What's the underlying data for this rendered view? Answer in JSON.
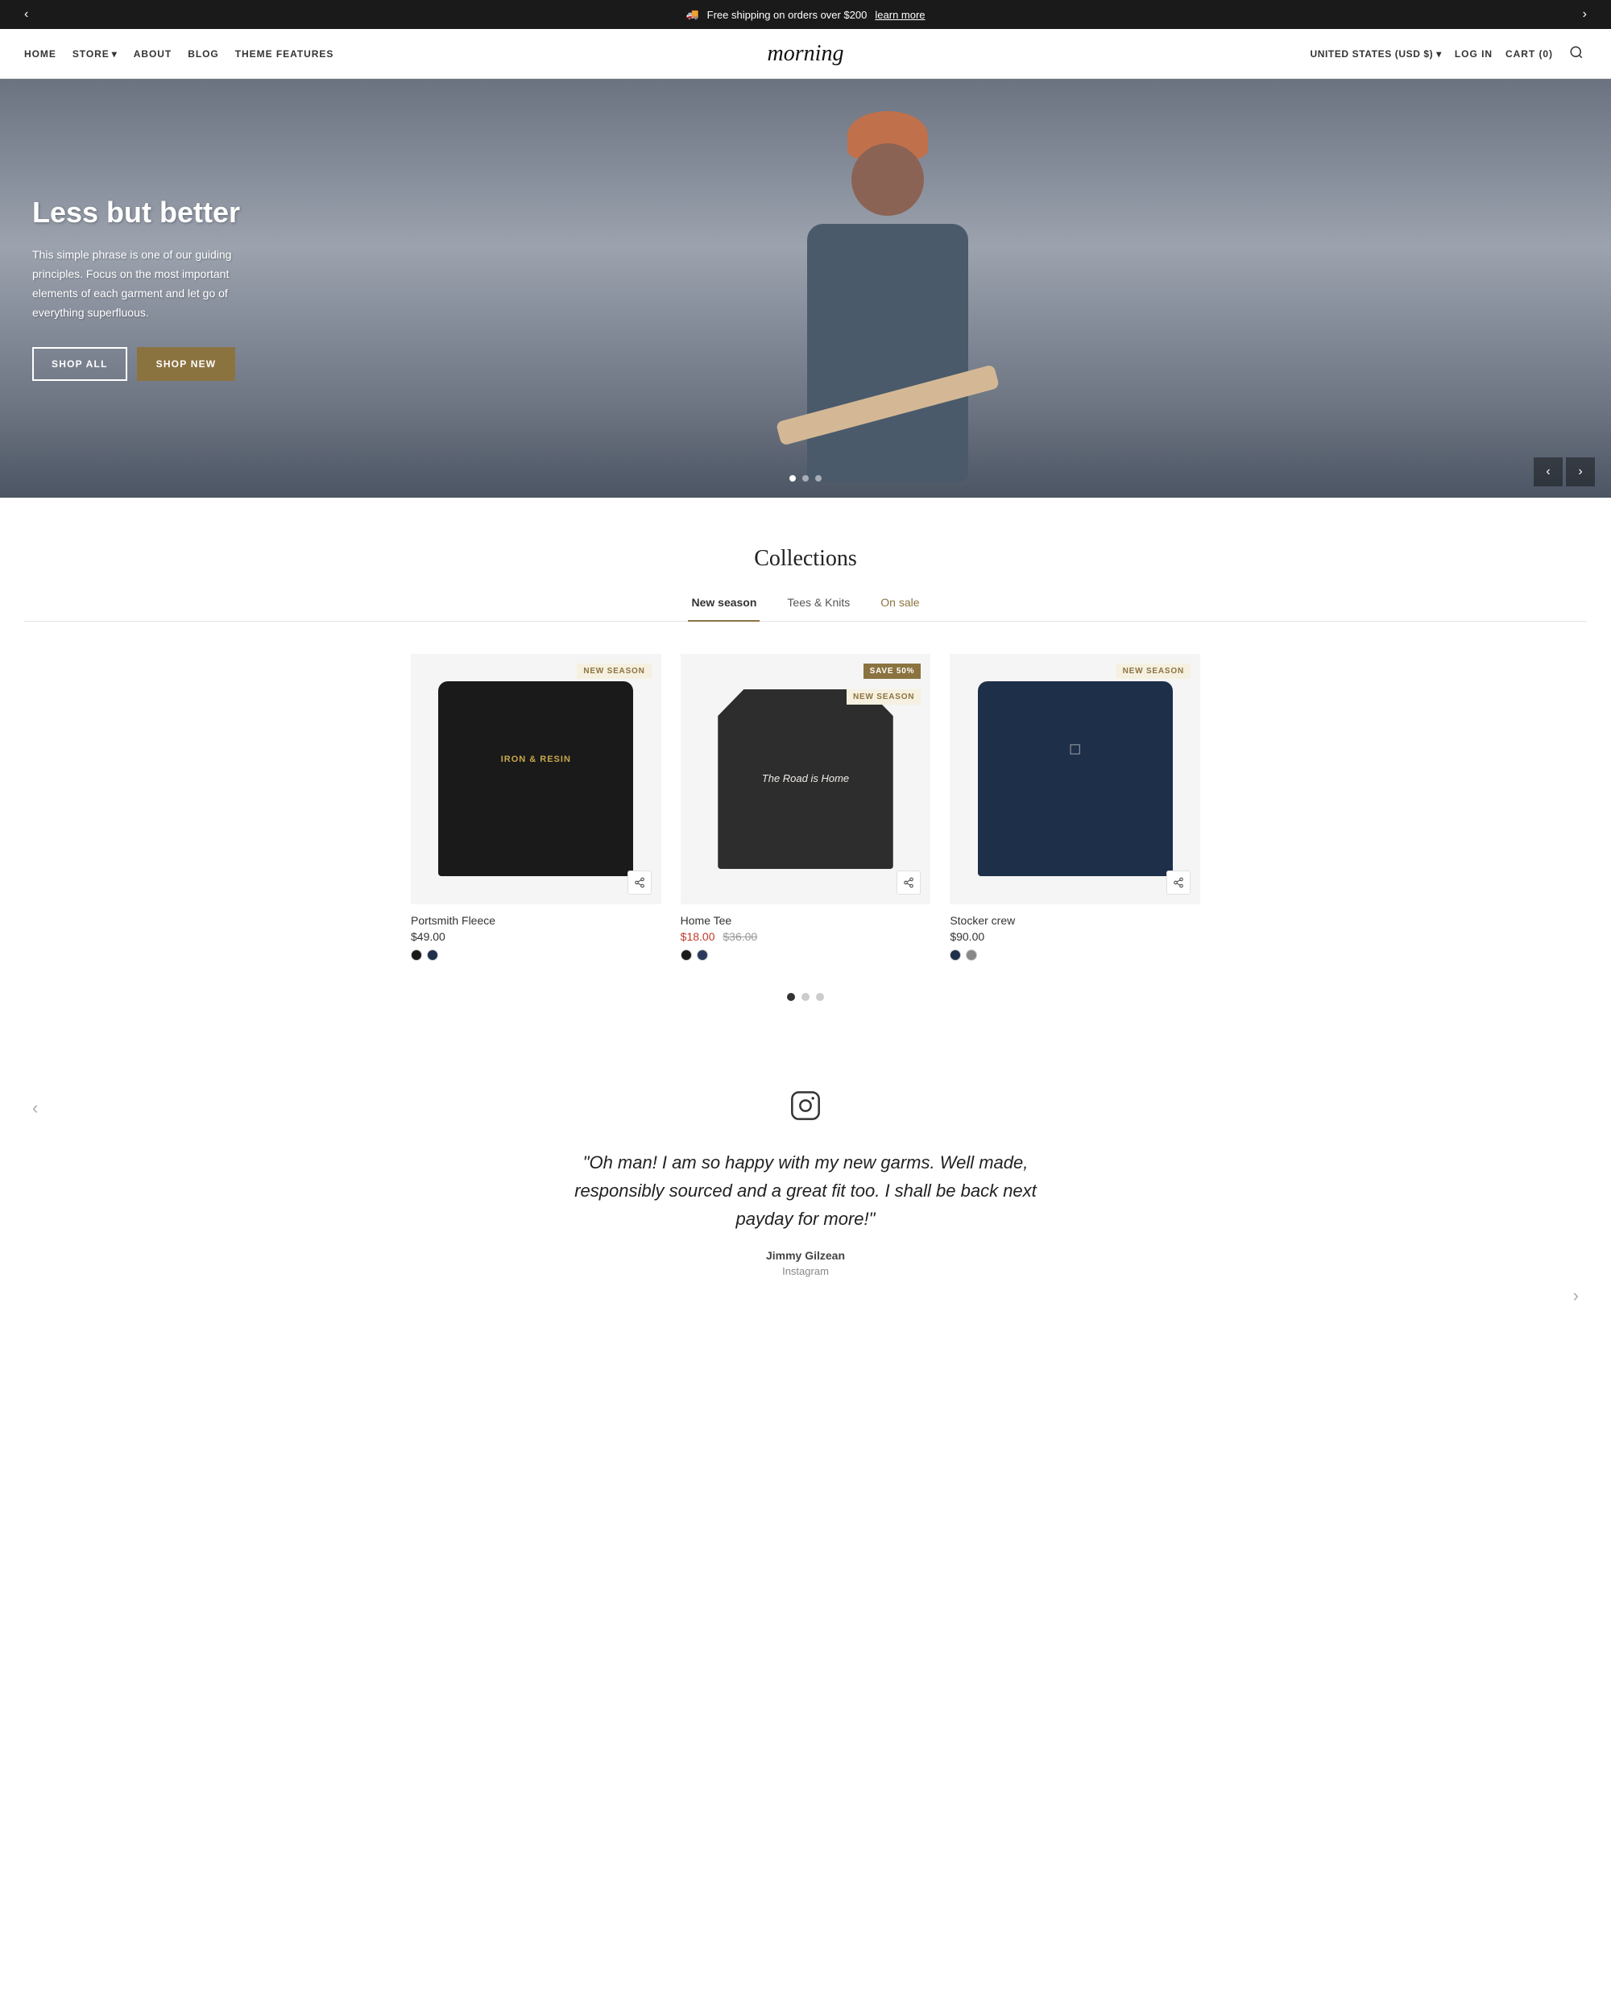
{
  "announcement": {
    "message": "Free shipping on orders over $200",
    "link_text": "learn more",
    "prev_label": "‹",
    "next_label": "›"
  },
  "header": {
    "logo": "morning",
    "nav_left": [
      {
        "label": "HOME",
        "id": "home"
      },
      {
        "label": "STORE",
        "id": "store",
        "has_dropdown": true
      },
      {
        "label": "ABOUT",
        "id": "about"
      },
      {
        "label": "BLOG",
        "id": "blog"
      },
      {
        "label": "THEME FEATURES",
        "id": "theme-features"
      }
    ],
    "nav_right": [
      {
        "label": "UNITED STATES (USD $)",
        "id": "country"
      },
      {
        "label": "LOG IN",
        "id": "login"
      },
      {
        "label": "CART (0)",
        "id": "cart"
      }
    ],
    "search_label": "search"
  },
  "hero": {
    "title": "Less but better",
    "description": "This simple phrase is one of our guiding principles. Focus on the most important elements of each garment and let go of everything superfluous.",
    "btn_shop_all": "SHOP ALL",
    "btn_shop_new": "SHOP NEW",
    "dots": [
      {
        "active": true
      },
      {
        "active": false
      },
      {
        "active": false
      }
    ],
    "prev_label": "‹",
    "next_label": "›"
  },
  "collections": {
    "title": "Collections",
    "tabs": [
      {
        "label": "New season",
        "active": true,
        "sale": false
      },
      {
        "label": "Tees & Knits",
        "active": false,
        "sale": false
      },
      {
        "label": "On sale",
        "active": false,
        "sale": true
      }
    ],
    "products": [
      {
        "name": "Portsmith Fleece",
        "price": "$49.00",
        "sale_price": null,
        "original_price": null,
        "badge": "NEW SEASON",
        "badge_type": "new",
        "colors": [
          "dark",
          "navy"
        ],
        "type": "sweater1"
      },
      {
        "name": "Home Tee",
        "price": "$18.00",
        "sale_price": "$18.00",
        "original_price": "$36.00",
        "badge": "SAVE 50%",
        "badge_type": "sale",
        "badge2": "NEW SEASON",
        "colors": [
          "dark",
          "navy2"
        ],
        "type": "tee1"
      },
      {
        "name": "Stocker crew",
        "price": "$90.00",
        "sale_price": null,
        "original_price": null,
        "badge": "NEW SEASON",
        "badge_type": "new",
        "colors": [
          "navy",
          "gray"
        ],
        "type": "sweater2"
      }
    ],
    "pagination": [
      {
        "active": true
      },
      {
        "active": false
      },
      {
        "active": false
      }
    ]
  },
  "testimonial": {
    "icon": "📷",
    "quote": "\"Oh man! I am so happy with my new garms. Well made, responsibly sourced and a great fit too. I shall be back next payday for more!\"",
    "author": "Jimmy Gilzean",
    "source": "Instagram",
    "prev_label": "‹",
    "next_label": "›"
  }
}
